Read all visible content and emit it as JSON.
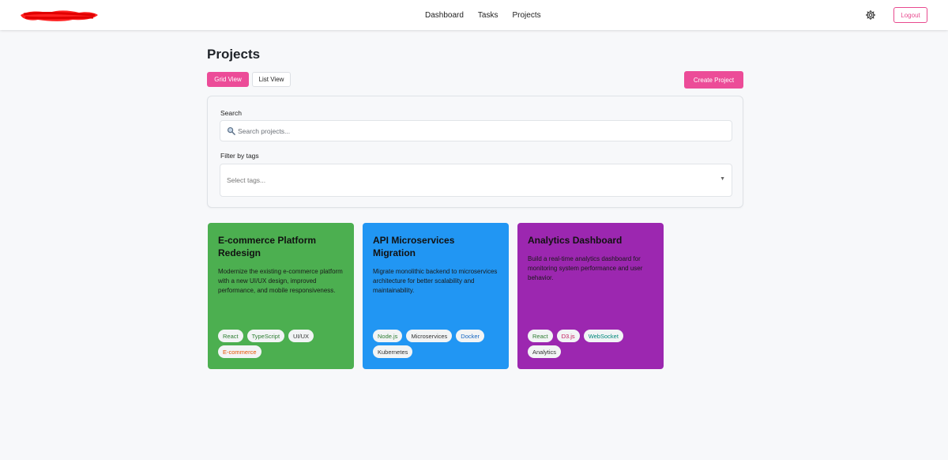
{
  "nav": {
    "items": [
      {
        "label": "Dashboard"
      },
      {
        "label": "Tasks"
      },
      {
        "label": "Projects"
      }
    ],
    "logout_label": "Logout",
    "icons": {
      "settings": "gear-icon"
    }
  },
  "page": {
    "title": "Projects"
  },
  "toolbar": {
    "grid_view_label": "Grid View",
    "list_view_label": "List View",
    "create_project_label": "Create Project"
  },
  "filters": {
    "search_label": "Search",
    "search_placeholder": "Search projects...",
    "search_value": "",
    "tags_label": "Filter by tags",
    "tags_placeholder": "Select tags..."
  },
  "colors": {
    "accent": "#ec4c98",
    "card_green": "#4caf50",
    "card_blue": "#2196f3",
    "card_purple": "#9c27b0"
  },
  "projects": [
    {
      "title": "E-commerce Platform Redesign",
      "description": "Modernize the existing e-commerce platform with a new UI/UX design, improved performance, and mobile responsiveness.",
      "tags": [
        {
          "label": "React",
          "color": "#2e7d32"
        },
        {
          "label": "TypeScript",
          "color": "#2e7d32"
        },
        {
          "label": "UI/UX",
          "color": "#333333"
        },
        {
          "label": "E-commerce",
          "color": "#e65100"
        }
      ]
    },
    {
      "title": "API Microservices Migration",
      "description": "Migrate monolithic backend to microservices architecture for better scalability and maintainability.",
      "tags": [
        {
          "label": "Node.js",
          "color": "#2e7d32"
        },
        {
          "label": "Microservices",
          "color": "#333333"
        },
        {
          "label": "Docker",
          "color": "#1565c0"
        },
        {
          "label": "Kubernetes",
          "color": "#333333"
        }
      ]
    },
    {
      "title": "Analytics Dashboard",
      "description": "Build a real-time analytics dashboard for monitoring system performance and user behavior.",
      "tags": [
        {
          "label": "React",
          "color": "#2e7d32"
        },
        {
          "label": "D3.js",
          "color": "#c2185b"
        },
        {
          "label": "WebSocket",
          "color": "#00897b"
        },
        {
          "label": "Analytics",
          "color": "#333333"
        }
      ]
    }
  ]
}
